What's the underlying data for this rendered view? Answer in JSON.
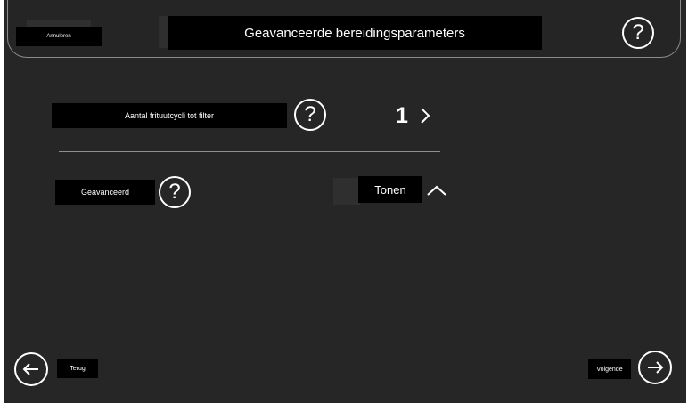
{
  "header": {
    "cancel_label": "Annuleren",
    "title": "Geavanceerde bereidingsparameters",
    "help_icon": "question-circle-icon"
  },
  "filter_row": {
    "label": "Aantal frituutcycli tot filter",
    "value": "1",
    "help_icon": "question-circle-icon",
    "chevron_icon": "chevron-right-icon"
  },
  "advanced_row": {
    "label": "Geavanceerd",
    "toggle_label": "Tonen",
    "help_icon": "question-circle-icon",
    "chevron_icon": "chevron-up-icon"
  },
  "footer": {
    "back_label": "Terug",
    "next_label": "Volgende",
    "back_icon": "arrow-left-icon",
    "next_icon": "arrow-right-icon"
  },
  "colors": {
    "background": "#262626",
    "label_box": "#000000",
    "text": "#ffffff",
    "divider": "#8f8f8f"
  }
}
